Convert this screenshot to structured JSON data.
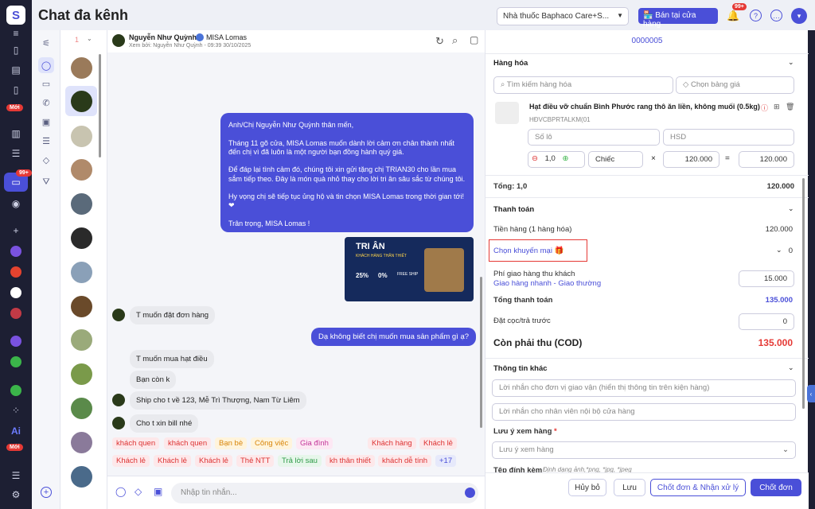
{
  "app": {
    "title": "Chat đa kênh",
    "store": "Nhà thuốc Baphaco Care+S...",
    "sell_button": "Bán tại cửa hàng",
    "notif_badge": "99+"
  },
  "rail": {
    "moi1": "Mới",
    "badge99": "99+",
    "moi2": "Mới",
    "ai": "Ai"
  },
  "chat": {
    "name": "Nguyễn Như Quỳnh",
    "channel": "MISA Lomas",
    "seen": "Xem bởi: Nguyễn Như Quỳnh - 09:39 30/10/2025",
    "promo_text": "Anh/Chị Nguyễn Như Quỳnh thân mến,\n\n Tháng 11 gõ cửa, MISA Lomas  muốn dành lời cảm ơn chân thành nhất đến chị vì đã luôn là một người bạn đồng hành quý giá.\n\n Để đáp lại tình cảm đó, chúng tôi xin gửi tặng chị TRIAN30  cho lần mua sắm tiếp theo. Đây là món quà nhỏ thay cho lời tri ân sâu sắc từ chúng tôi.\n\n Hy vọng chị sẽ tiếp tục ủng hộ và tin chọn MISA Lomas  trong thời gian tới! ❤\n\n Trân trọng, MISA Lomas !",
    "banner_title": "TRI ÂN",
    "banner_sub": "KHÁCH HÀNG THÂN THIẾT",
    "banner_25": "25%",
    "banner_0": "0%",
    "banner_free": "FREE SHIP",
    "m1": "T muốn đặt đơn hàng",
    "m2": "Dạ không biết chị muốn mua sản phẩm gì ạ?",
    "m3": "T muốn mua hạt điều",
    "m4": "Bạn còn k",
    "m5": "Ship cho t về 123, Mễ Trì Thượng, Nam Từ Liêm",
    "m6": "Cho t xin bill nhé",
    "tags_row1": [
      "khách quen",
      "khách quen",
      "Bạn bè",
      "Công việc",
      "Gia đình",
      "Khách hàng",
      "Khách lẻ"
    ],
    "tags_row2": [
      "Khách lẻ",
      "Khách lẻ",
      "Khách lẻ",
      "Thẻ NTT",
      "Trả lời sau",
      "kh thân thiết",
      "khách dễ tính",
      "+17"
    ],
    "input_placeholder": "Nhập tin nhắn...",
    "unread": "1"
  },
  "order": {
    "code": "0000005",
    "goods_title": "Hàng hóa",
    "search_ph": "Tìm kiếm hàng hóa",
    "price_ph": "Chọn bảng giá",
    "product": "Hạt điều vỡ chuẩn Bình Phước rang thô ăn liền, không muối (0.5kg)",
    "sku": "HĐVCBPRTALKM(01",
    "lot_ph": "Số lô",
    "hsd_ph": "HSD",
    "qty": "1,0",
    "unit": "Chiếc",
    "price": "120.000",
    "amount": "120.000",
    "times": "×",
    "equals": "=",
    "total_label": "Tổng: 1,0",
    "total_val": "120.000",
    "pay_title": "Thanh toán",
    "goods_money_label": "Tiền hàng (1 hàng hóa)",
    "goods_money": "120.000",
    "promo_label": "Chọn khuyến mại",
    "promo_val": "0",
    "ship_label": "Phí giao hàng thu khách",
    "ship_provider": "Giao hàng nhanh - Giao thường",
    "ship_val": "15.000",
    "grand_label": "Tổng thanh toán",
    "grand_val": "135.000",
    "deposit_label": "Đặt cọc/trả trước",
    "deposit_val": "0",
    "cod_label": "Còn phải thu (COD)",
    "cod_val": "135.000",
    "other_title": "Thông tin khác",
    "note1_ph": "Lời nhắn cho đơn vị giao vận (hiển thị thông tin trên kiện hàng)",
    "note2_ph": "Lời nhắn cho nhân viên nội bộ cửa hàng",
    "watch_label": "Lưu ý xem hàng",
    "watch_req": "*",
    "watch_ph": "Lưu ý xem hàng",
    "attach_label": "Tệp đính kèm",
    "attach_hint": "Định dạng ảnh,*png, *jpg, *jpeg",
    "btn_cancel": "Hủy bỏ",
    "btn_save": "Lưu",
    "btn_close_accept": "Chốt đơn & Nhận xử lý",
    "btn_close": "Chốt đơn"
  },
  "colors": {
    "accent": "#4a4fd8",
    "danger": "#e53935"
  }
}
